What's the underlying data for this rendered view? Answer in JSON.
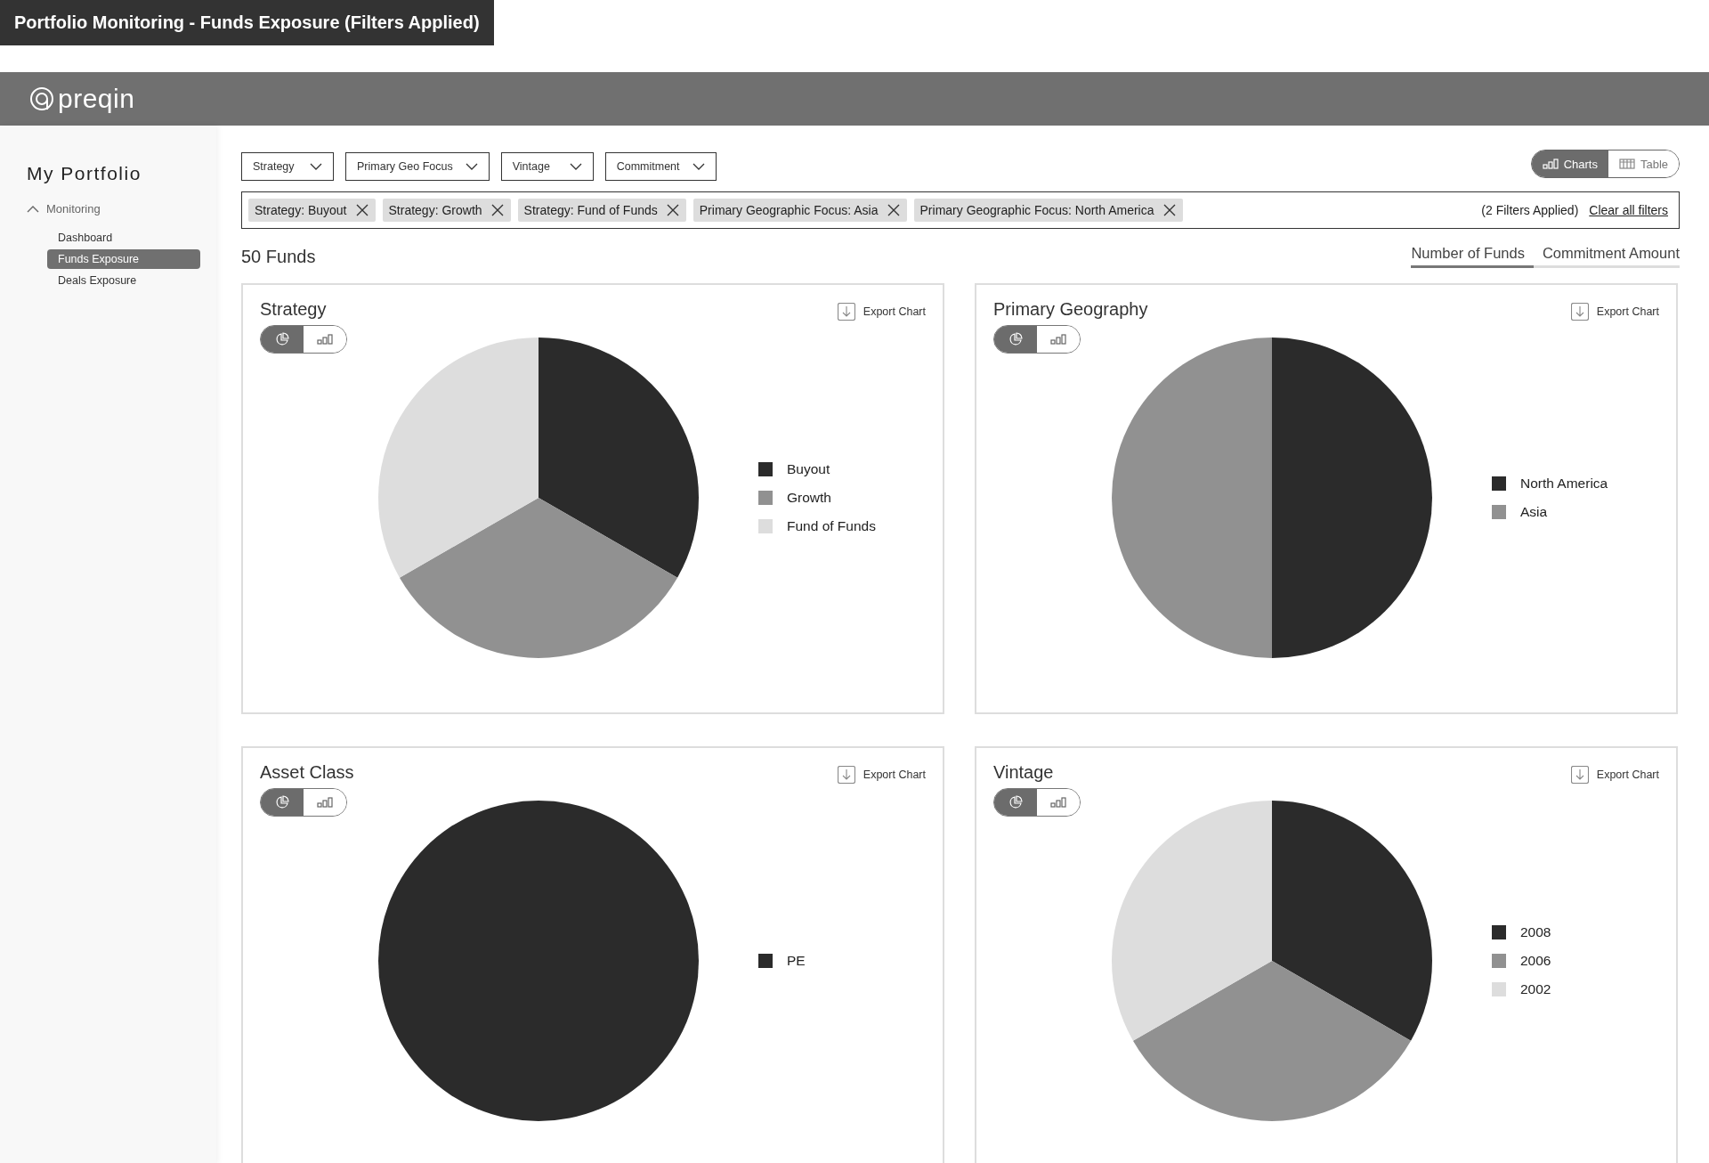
{
  "page_title": "Portfolio Monitoring - Funds Exposure (Filters Applied)",
  "brand": {
    "name": "preqin"
  },
  "sidebar": {
    "title": "My Portfolio",
    "section": {
      "label": "Monitoring",
      "expanded": true,
      "items": [
        {
          "label": "Dashboard",
          "selected": false
        },
        {
          "label": "Funds Exposure",
          "selected": true
        },
        {
          "label": "Deals Exposure",
          "selected": false
        }
      ]
    }
  },
  "filters": [
    {
      "label": "Strategy"
    },
    {
      "label": "Primary Geo Focus"
    },
    {
      "label": "Vintage"
    },
    {
      "label": "Commitment"
    }
  ],
  "view_toggle": [
    {
      "label": "Charts",
      "selected": true
    },
    {
      "label": "Table",
      "selected": false
    }
  ],
  "applied_filters": [
    {
      "label": "Strategy: Buyout"
    },
    {
      "label": "Strategy: Growth"
    },
    {
      "label": "Strategy: Fund of Funds"
    },
    {
      "label": "Primary Geographic Focus: Asia"
    },
    {
      "label": "Primary Geographic Focus: North America"
    }
  ],
  "filter_count": "(2 Filters Applied)",
  "clear_link": "Clear all filters",
  "result_count": "50 Funds",
  "measure_tabs": [
    {
      "label": "Number of Funds",
      "selected": true
    },
    {
      "label": "Commitment Amount",
      "selected": false
    }
  ],
  "cards": [
    {
      "title": "Strategy",
      "export": "Export Chart",
      "chart_view": [
        {
          "kind": "pie",
          "selected": true
        },
        {
          "kind": "bar",
          "selected": false
        }
      ],
      "chart_data": {
        "type": "pie",
        "categories": [
          "Buyout",
          "Growth",
          "Fund of Funds"
        ],
        "values": [
          33.3,
          33.4,
          33.3
        ],
        "colors": [
          "#2b2b2b",
          "#919191",
          "#dddddd"
        ],
        "legend": "right"
      }
    },
    {
      "title": "Primary Geography",
      "export": "Export Chart",
      "chart_view": [
        {
          "kind": "pie",
          "selected": true
        },
        {
          "kind": "bar",
          "selected": false
        }
      ],
      "chart_data": {
        "type": "pie",
        "categories": [
          "North America",
          "Asia"
        ],
        "values": [
          50,
          50
        ],
        "colors": [
          "#2b2b2b",
          "#919191"
        ],
        "legend": "right"
      }
    },
    {
      "title": "Asset Class",
      "export": "Export Chart",
      "chart_view": [
        {
          "kind": "pie",
          "selected": true
        },
        {
          "kind": "bar",
          "selected": false
        }
      ],
      "chart_data": {
        "type": "pie",
        "categories": [
          "PE"
        ],
        "values": [
          100
        ],
        "colors": [
          "#2b2b2b"
        ],
        "legend": "right"
      }
    },
    {
      "title": "Vintage",
      "export": "Export Chart",
      "chart_view": [
        {
          "kind": "pie",
          "selected": true
        },
        {
          "kind": "bar",
          "selected": false
        }
      ],
      "chart_data": {
        "type": "pie",
        "categories": [
          "2008",
          "2006",
          "2002"
        ],
        "values": [
          33.3,
          33.4,
          33.3
        ],
        "colors": [
          "#2b2b2b",
          "#919191",
          "#dddddd"
        ],
        "legend": "right"
      }
    }
  ]
}
